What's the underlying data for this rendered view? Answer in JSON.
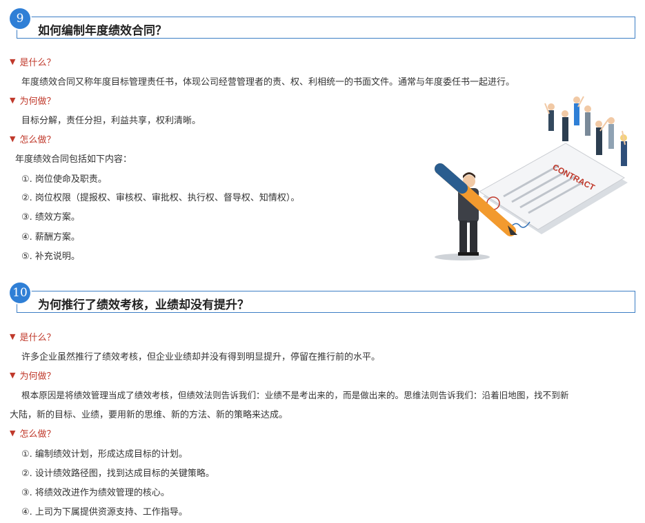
{
  "sections": [
    {
      "number": "9",
      "title": "如何编制年度绩效合同？",
      "what_label": "是什么？",
      "what_text": "年度绩效合同又称年度目标管理责任书，体现公司经营管理者的责、权、利相统一的书面文件。通常与年度委任书一起进行。",
      "why_label": "为何做？",
      "why_text": "目标分解，责任分担，利益共享，权利清晰。",
      "how_label": "怎么做？",
      "how_intro": "年度绩效合同包括如下内容：",
      "how_items": [
        "①. 岗位使命及职责。",
        "②. 岗位权限（提报权、审核权、审批权、执行权、督导权、知情权）。",
        "③. 绩效方案。",
        "④. 薪酬方案。",
        "⑤. 补充说明。"
      ]
    },
    {
      "number": "10",
      "title": "为何推行了绩效考核，业绩却没有提升？",
      "what_label": "是什么？",
      "what_text": "许多企业虽然推行了绩效考核，但企业业绩却并没有得到明显提升，停留在推行前的水平。",
      "why_label": "为何做？",
      "why_text_1": "根本原因是将绩效管理当成了绩效考核，但绩效法则告诉我们：业绩不是考出来的，而是做出来的。思维法则告诉我们：沿着旧地图，找不到新",
      "why_text_2": "大陆，新的目标、业绩，要用新的思维、新的方法、新的策略来达成。",
      "how_label": "怎么做？",
      "how_items": [
        "①. 编制绩效计划，形成达成目标的计划。",
        "②. 设计绩效路径图，找到达成目标的关键策略。",
        "③. 将绩效改进作为绩效管理的核心。",
        "④. 上司为下属提供资源支持、工作指导。"
      ]
    }
  ],
  "illustration": {
    "contract_word": "CONTRACT"
  },
  "icons": {
    "bullet": "triangle-down-icon"
  },
  "colors": {
    "accent": "#2f7fd6",
    "label": "#c0392b",
    "border": "#3b7dc4"
  }
}
